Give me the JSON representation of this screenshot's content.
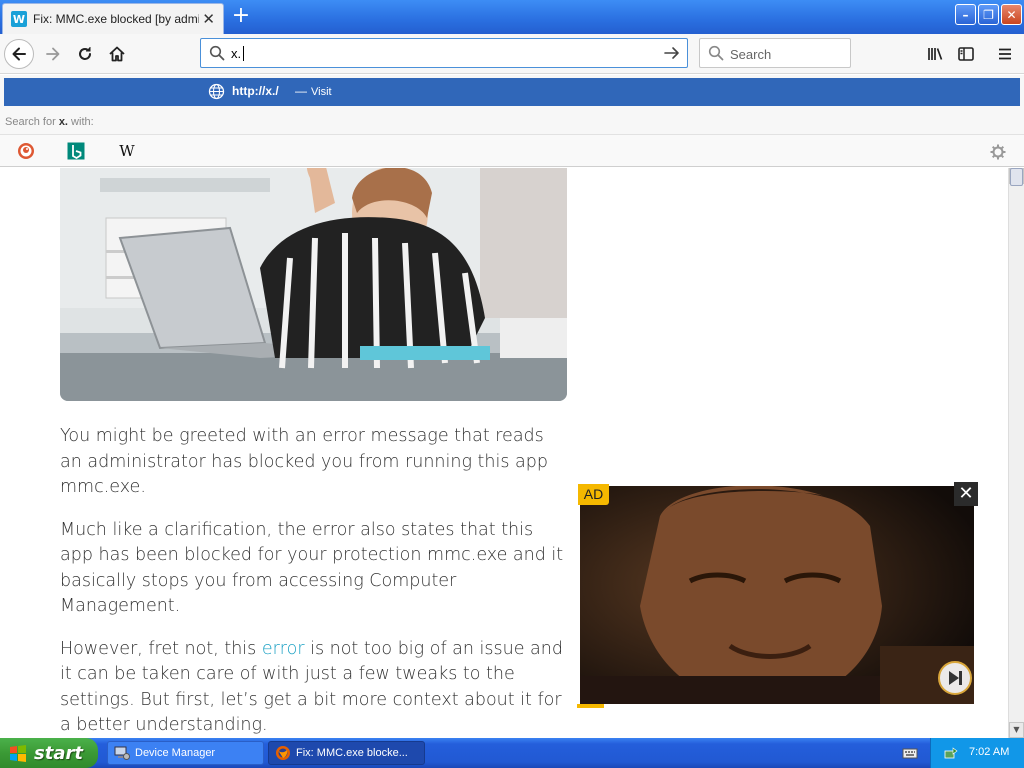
{
  "browser": {
    "tab": {
      "favicon_letter": "W",
      "title": "Fix: MMC.exe blocked [by administrator]",
      "close_glyph": "✕"
    },
    "new_tab_glyph": "+",
    "window_buttons": {
      "minimize": "–",
      "restore": "❐",
      "close": "✕"
    },
    "url_value": "x.",
    "search_placeholder": "Search"
  },
  "dropdown": {
    "suggestion_url": "http://x./",
    "suggestion_dash": "—",
    "suggestion_action": "Visit",
    "search_with_prefix": "Search for ",
    "search_with_term": "x.",
    "search_with_suffix": " with:",
    "engines": [
      "duckduckgo-icon",
      "bing-icon",
      "wikipedia-icon"
    ],
    "wikipedia_glyph": "W"
  },
  "article": {
    "para1": "You might be greeted with an error message that reads an administrator has blocked you from running this app mmc.exe.",
    "para2": "Much like a clarification, the error also states that this app has been blocked for your protection mmc.exe and it basically stops you from accessing Computer Management.",
    "para3_before": "However, fret not, this ",
    "para3_link": "error",
    "para3_after": " is not too big of an issue and it can be taken care of with just a few tweaks to the settings. But first, let’s get a bit more context about it for a better understanding."
  },
  "ad": {
    "badge": "AD",
    "close_glyph": "✕"
  },
  "taskbar": {
    "start_label": "start",
    "tasks": [
      {
        "label": "Device Manager"
      },
      {
        "label": "Fix: MMC.exe blocke..."
      }
    ],
    "clock": "7:02 AM"
  },
  "colors": {
    "accent": "#3067b9",
    "link": "#1ba1c4",
    "ad_badge": "#f5b800",
    "taskbar": "#245edb",
    "start": "#3b9a35"
  }
}
